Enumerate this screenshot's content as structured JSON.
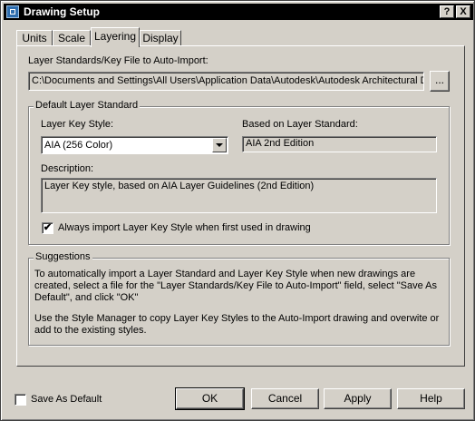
{
  "window": {
    "title": "Drawing Setup",
    "help_button": "?",
    "close_button": "X"
  },
  "tabs": [
    {
      "label": "Units"
    },
    {
      "label": "Scale"
    },
    {
      "label": "Layering",
      "active": true
    },
    {
      "label": "Display"
    }
  ],
  "layering": {
    "key_file_label": "Layer Standards/Key File to Auto-Import:",
    "key_file_path": "C:\\Documents and Settings\\All Users\\Application Data\\Autodesk\\Autodesk Architectural D",
    "browse_button": "...",
    "default_group_title": "Default Layer Standard",
    "key_style_label": "Layer Key Style:",
    "key_style_value": "AIA (256 Color)",
    "based_on_label": "Based on Layer Standard:",
    "based_on_value": "AIA 2nd Edition",
    "description_label": "Description:",
    "description_value": "Layer Key style, based on AIA Layer Guidelines (2nd Edition)",
    "always_import_label": "Always import Layer Key Style when first used in drawing",
    "always_import_checked": "✔",
    "suggestions_title": "Suggestions",
    "suggestion_1": "To automatically import a Layer Standard and Layer Key Style when new drawings are created, select a file for the \"Layer Standards/Key File to Auto-Import\" field, select \"Save As Default\", and click \"OK\"",
    "suggestion_2": "Use the Style Manager to copy Layer Key Styles to the Auto-Import drawing and overwite or add to the existing styles."
  },
  "footer": {
    "save_as_default_label": "Save As Default",
    "ok_label": "OK",
    "cancel_label": "Cancel",
    "apply_label": "Apply",
    "help_label": "Help"
  }
}
